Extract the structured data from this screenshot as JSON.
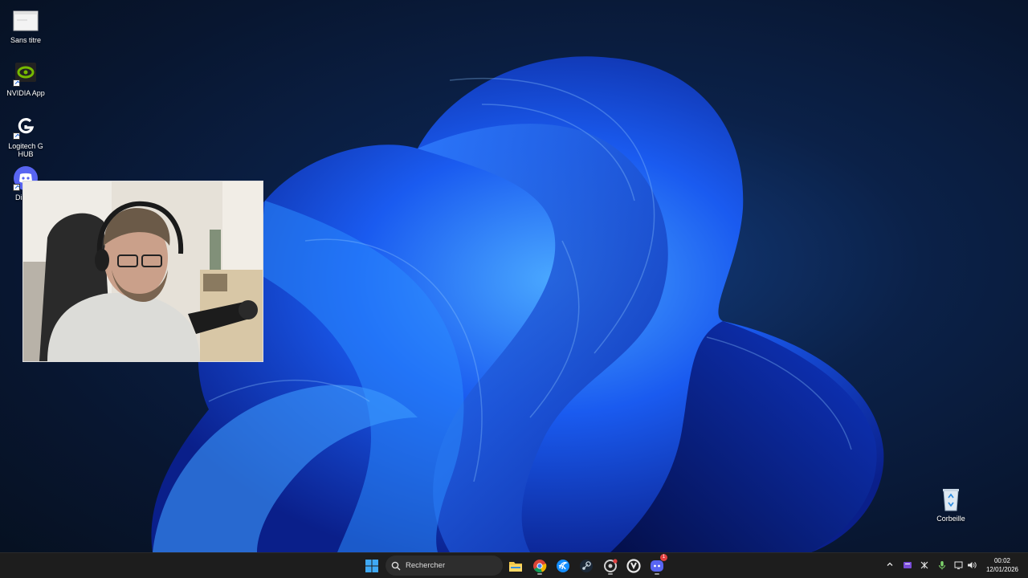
{
  "desktop": {
    "icons": [
      {
        "label": "Sans titre",
        "icon": "blank-document-icon"
      },
      {
        "label": "NVIDIA App",
        "icon": "nvidia-icon"
      },
      {
        "label": "Logitech G HUB",
        "icon": "logitech-g-icon"
      },
      {
        "label": "Dis",
        "icon": "discord-icon"
      },
      {
        "label": "Corbeille",
        "icon": "recycle-bin-icon"
      }
    ]
  },
  "webcam": {
    "description_icon": "webcam-overlay"
  },
  "taskbar": {
    "search_placeholder": "Rechercher",
    "pinned": [
      {
        "icon": "start-icon"
      },
      {
        "icon": "file-explorer-icon"
      },
      {
        "icon": "chrome-icon"
      },
      {
        "icon": "battlenet-icon"
      },
      {
        "icon": "steam-icon"
      },
      {
        "icon": "settings-app-icon"
      },
      {
        "icon": "overwatch-icon"
      },
      {
        "icon": "discord-icon"
      }
    ],
    "discord_badge": "1",
    "clock": {
      "time": "00:02",
      "date": "12/01/2026"
    }
  },
  "colors": {
    "accent": "#1a6fe8",
    "taskbar": "#1d1d1d",
    "discord": "#5865f2",
    "nvidia": "#76b900"
  }
}
